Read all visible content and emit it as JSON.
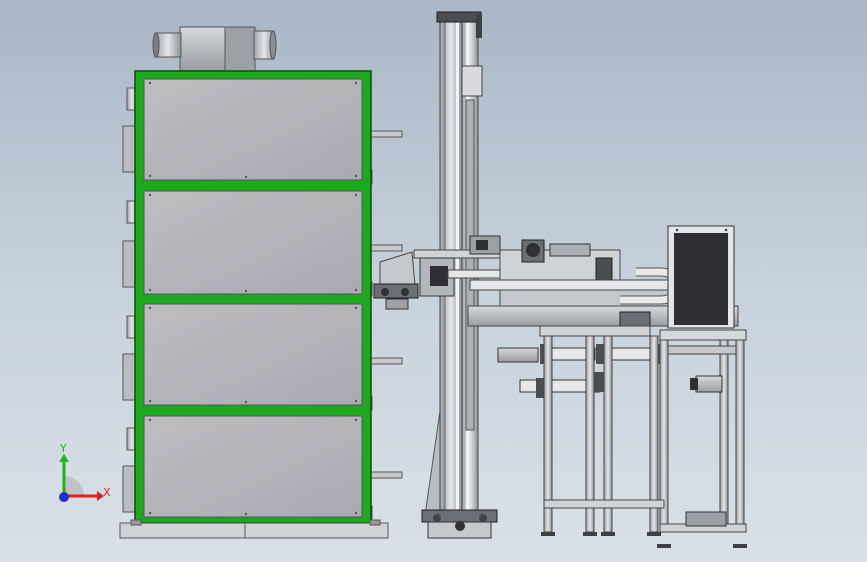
{
  "viewport": {
    "background_top": "#a9b7c6",
    "background_bottom": "#d9e0e7"
  },
  "model": {
    "cabinet_frame_color": "#1ea81e",
    "panel_color": "#b2b2ba",
    "steel_color": "#c8cacd",
    "dark_part_color": "#2e3035"
  },
  "triad": {
    "x_label": "X",
    "y_label": "Y",
    "x_color": "#e02020",
    "y_color": "#20b020",
    "z_color": "#2030d0"
  }
}
